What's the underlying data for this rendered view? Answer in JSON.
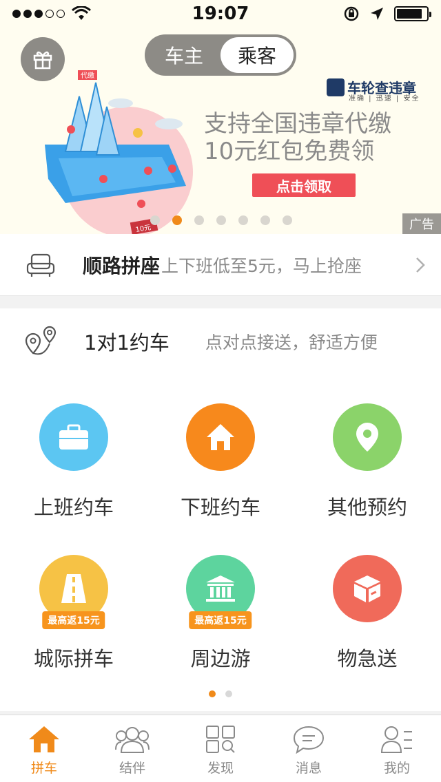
{
  "status_bar": {
    "time": "19:07",
    "battery_level": 0.85
  },
  "banner": {
    "role_toggle": {
      "driver_label": "车主",
      "passenger_label": "乘客",
      "selected": "乘客"
    },
    "ad_logo": "车轮查违章",
    "ad_logo_tagline": "准确 | 迅速 | 安全",
    "illustration_badge": "代缴",
    "illustration_ticket": "10元",
    "headline_1": "支持全国违章代缴",
    "headline_2": "10元红包免费领",
    "cta_label": "点击领取",
    "ad_tag": "广告",
    "pager": {
      "count": 7,
      "active_index": 1
    }
  },
  "carpool": {
    "title": "顺路拼座",
    "subtitle": "上下班低至5元，马上抢座"
  },
  "one_on_one": {
    "title": "1对1约车",
    "subtitle": "点对点接送，舒适方便"
  },
  "services": [
    {
      "label": "上班约车",
      "icon": "briefcase-icon",
      "color": "#5cc6f2",
      "promo": ""
    },
    {
      "label": "下班约车",
      "icon": "home-icon",
      "color": "#f7891c",
      "promo": ""
    },
    {
      "label": "其他预约",
      "icon": "location-pin-icon",
      "color": "#8bd36a",
      "promo": ""
    },
    {
      "label": "城际拼车",
      "icon": "road-icon",
      "color": "#f6c245",
      "promo": "最高返15元"
    },
    {
      "label": "周边游",
      "icon": "landmark-icon",
      "color": "#5dd49e",
      "promo": "最高返15元"
    },
    {
      "label": "物急送",
      "icon": "package-icon",
      "color": "#f06a5a",
      "promo": ""
    }
  ],
  "services_pager": {
    "count": 2,
    "active_index": 0
  },
  "tabbar": [
    {
      "label": "拼车",
      "icon": "home-icon",
      "active": true
    },
    {
      "label": "结伴",
      "icon": "people-icon",
      "active": false
    },
    {
      "label": "发现",
      "icon": "discover-grid-icon",
      "active": false
    },
    {
      "label": "消息",
      "icon": "chat-bubble-icon",
      "active": false
    },
    {
      "label": "我的",
      "icon": "profile-icon",
      "active": false
    }
  ],
  "colors": {
    "accent": "#f08a1a",
    "cta_red": "#ef4f57",
    "banner_bg": "#fffdf0"
  }
}
